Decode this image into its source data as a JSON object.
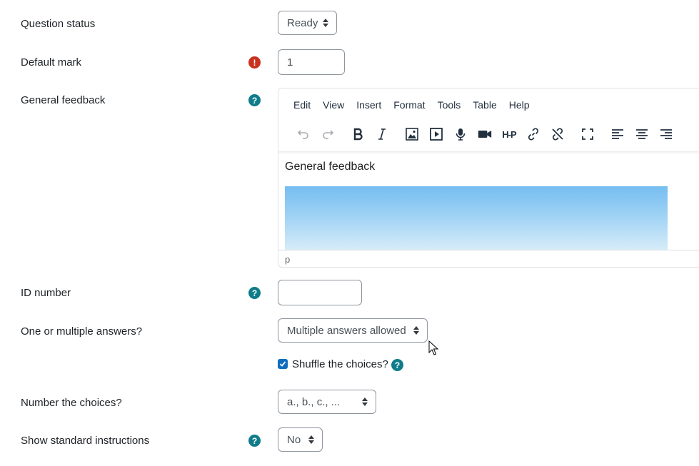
{
  "fields": {
    "question_status": {
      "label": "Question status",
      "value": "Ready"
    },
    "default_mark": {
      "label": "Default mark",
      "value": "1",
      "required_icon": "exclamation"
    },
    "general_feedback": {
      "label": "General feedback",
      "help_icon": "?",
      "menu": [
        "Edit",
        "View",
        "Insert",
        "Format",
        "Tools",
        "Table",
        "Help"
      ],
      "toolbar_icons": [
        "undo-icon",
        "redo-icon",
        "bold-icon",
        "italic-icon",
        "image-icon",
        "media-icon",
        "record-audio-icon",
        "record-video-icon",
        "h5p-icon",
        "link-icon",
        "unlink-icon",
        "fullscreen-icon",
        "align-left-icon",
        "align-center-icon",
        "align-right-icon"
      ],
      "h5p_text": "H-P",
      "content_text": "General feedback",
      "status_path": "p"
    },
    "id_number": {
      "label": "ID number",
      "value": "",
      "help_icon": "?"
    },
    "one_or_multiple": {
      "label": "One or multiple answers?",
      "value": "Multiple answers allowed"
    },
    "shuffle": {
      "label": "Shuffle the choices?",
      "checked": true,
      "help_icon": "?"
    },
    "number_choices": {
      "label": "Number the choices?",
      "value": "a., b., c., ..."
    },
    "show_instructions": {
      "label": "Show standard instructions",
      "value": "No",
      "help_icon": "?"
    }
  },
  "colors": {
    "help": "#0f7c8a",
    "required": "#ca3120",
    "checkbox": "#0f6cbf",
    "border": "#8f959e"
  }
}
